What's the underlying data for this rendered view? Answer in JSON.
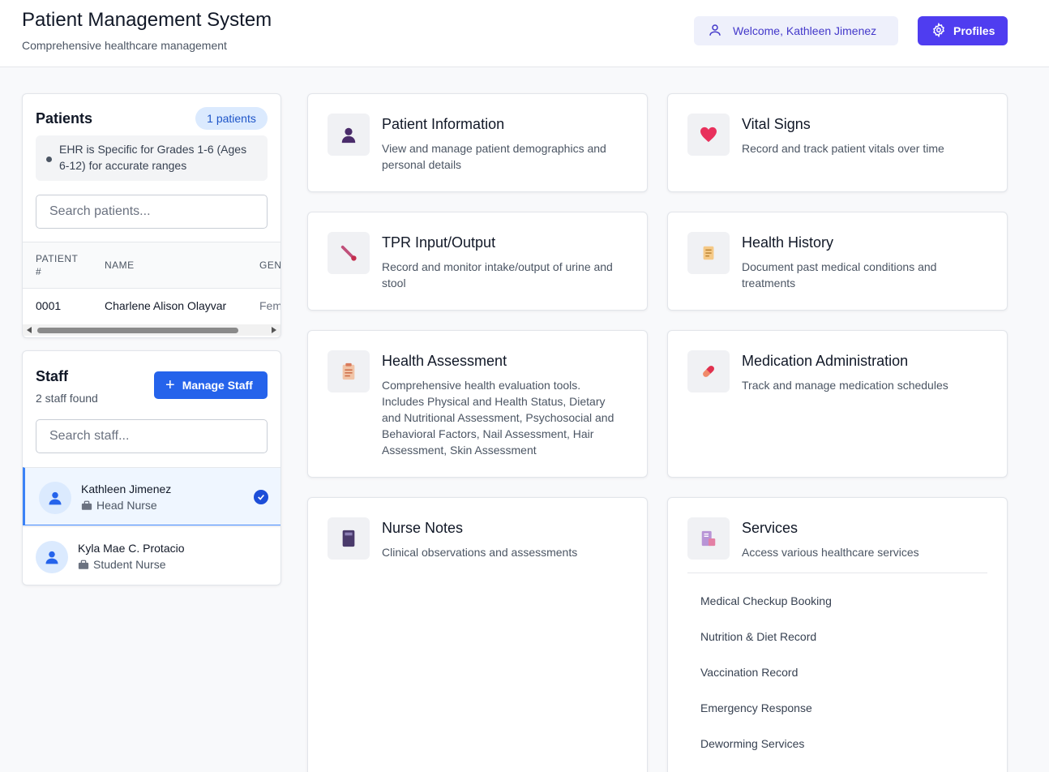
{
  "header": {
    "title": "Patient Management System",
    "subtitle": "Comprehensive healthcare management",
    "welcome": "Welcome, Kathleen Jimenez",
    "profiles_label": "Profiles"
  },
  "patients": {
    "title": "Patients",
    "badge": "1 patients",
    "note": "EHR is Specific for Grades 1-6 (Ages 6-12) for accurate ranges",
    "search_placeholder": "Search patients...",
    "columns": [
      "PATIENT #",
      "NAME",
      "GEN"
    ],
    "rows": [
      {
        "number": "0001",
        "name": "Charlene Alison Olayvar",
        "gender": "Fem"
      }
    ]
  },
  "staff": {
    "title": "Staff",
    "count": "2 staff found",
    "manage_label": "Manage Staff",
    "search_placeholder": "Search staff...",
    "members": [
      {
        "name": "Kathleen Jimenez",
        "role": "Head Nurse",
        "selected": true
      },
      {
        "name": "Kyla Mae C. Protacio",
        "role": "Student Nurse",
        "selected": false
      }
    ]
  },
  "modules": [
    {
      "title": "Patient Information",
      "description": "View and manage patient demographics and personal details",
      "icon": "person-silhouette-icon"
    },
    {
      "title": "Vital Signs",
      "description": "Record and track patient vitals over time",
      "icon": "heart-icon"
    },
    {
      "title": "TPR Input/Output",
      "description": "Record and monitor intake/output of urine and stool",
      "icon": "thermometer-icon"
    },
    {
      "title": "Health History",
      "description": "Document past medical conditions and treatments",
      "icon": "scroll-icon"
    },
    {
      "title": "Health Assessment",
      "description": "Comprehensive health evaluation tools. Includes Physical and Health Status, Dietary and Nutritional Assessment, Psychosocial and Behavioral Factors, Nail Assessment, Hair Assessment, Skin Assessment",
      "icon": "clipboard-icon"
    },
    {
      "title": "Medication Administration",
      "description": "Track and manage medication schedules",
      "icon": "pill-icon"
    },
    {
      "title": "Nurse Notes",
      "description": "Clinical observations and assessments",
      "icon": "notebook-icon"
    },
    {
      "title": "Services",
      "description": "Access various healthcare services",
      "icon": "medical-record-icon"
    }
  ],
  "services": [
    "Medical Checkup Booking",
    "Nutrition & Diet Record",
    "Vaccination Record",
    "Emergency Response",
    "Deworming Services"
  ],
  "colors": {
    "accent": "#4f3df0",
    "primary_blue": "#2563eb",
    "badge_bg": "#dbeafe"
  }
}
